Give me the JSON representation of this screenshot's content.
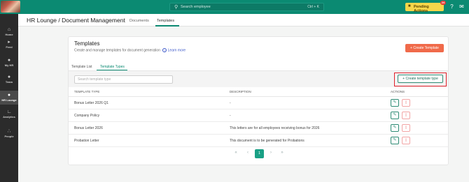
{
  "topbar": {
    "search_placeholder": "Search employee",
    "search_shortcut": "Ctrl + K",
    "pending_label": "Pending Actions",
    "pending_count": "24"
  },
  "sidebar": {
    "items": [
      {
        "label": "Home",
        "icon": "home-icon"
      },
      {
        "label": "Feed",
        "icon": "megaphone-icon"
      },
      {
        "label": "My HR",
        "icon": "user-icon"
      },
      {
        "label": "Team",
        "icon": "team-icon"
      },
      {
        "label": "HR Lounge",
        "icon": "hr-lounge-icon"
      },
      {
        "label": "Analytics",
        "icon": "chart-icon"
      },
      {
        "label": "People",
        "icon": "people-icon"
      }
    ]
  },
  "header": {
    "title": "HR Lounge  /  Document Management",
    "tabs": [
      "Documents",
      "Templates"
    ]
  },
  "card": {
    "title": "Templates",
    "subtitle": "Create and manage templates for document generation",
    "learn_more": "Learn more",
    "create_button": "+ Create Template",
    "tabs": [
      "Template List",
      "Template Types"
    ],
    "search_placeholder": "Search template type",
    "create_type_button": "Create template type",
    "columns": [
      "TEMPLATE TYPE",
      "DESCRIPTION",
      "ACTIONS"
    ],
    "rows": [
      {
        "type": "Bonus Letter 2026 Q1",
        "description": "-"
      },
      {
        "type": "Company Policy",
        "description": "-"
      },
      {
        "type": "Bonus Letter 2026",
        "description": "This letters are for all employees receiving bonus for 2026"
      },
      {
        "type": "Probation Letter",
        "description": "This document is to be generated for Probations"
      }
    ],
    "pagination": {
      "current": "1"
    }
  },
  "colors": {
    "brand": "#0b8a72",
    "accent": "#f06a4a",
    "highlight": "#e0202a",
    "pending": "#f6d64a"
  }
}
